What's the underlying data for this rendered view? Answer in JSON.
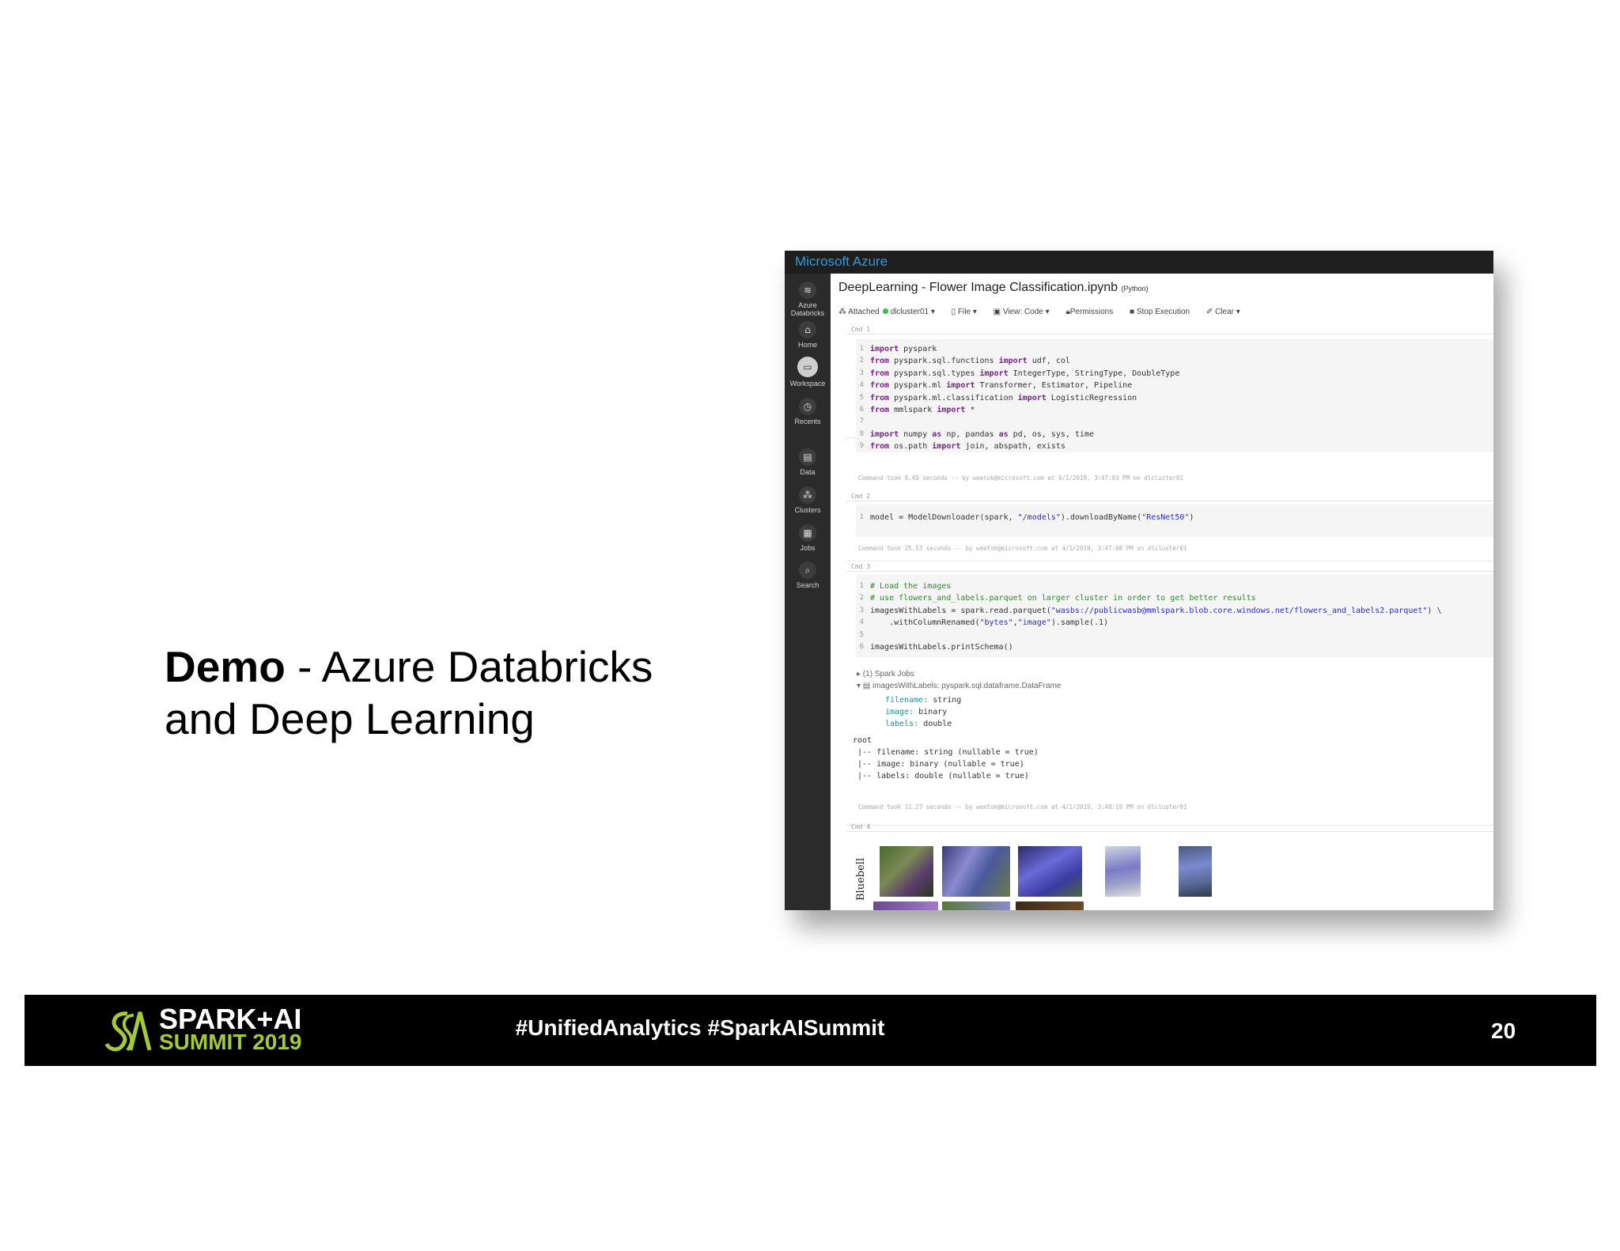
{
  "slide": {
    "title_bold": "Demo",
    "title_rest_line1": " - Azure Databricks",
    "title_line2": "and Deep Learning"
  },
  "app": {
    "brand": "Microsoft Azure",
    "notebook_title": "DeepLearning - Flower Image Classification.ipynb",
    "language": "(Python)"
  },
  "sidebar": {
    "items": [
      {
        "label": "Azure Databricks",
        "icon": "layers-icon"
      },
      {
        "label": "Home",
        "icon": "home-icon"
      },
      {
        "label": "Workspace",
        "icon": "folder-icon"
      },
      {
        "label": "Recents",
        "icon": "clock-icon"
      },
      {
        "label": "Data",
        "icon": "database-icon"
      },
      {
        "label": "Clusters",
        "icon": "cluster-icon"
      },
      {
        "label": "Jobs",
        "icon": "calendar-icon"
      },
      {
        "label": "Search",
        "icon": "search-icon"
      }
    ]
  },
  "toolbar": {
    "attached": "Attached",
    "cluster": "dlcluster01 ▾",
    "file": "File ▾",
    "view": "View: Code ▾",
    "permissions": "Permissions",
    "stop": "Stop Execution",
    "clear": "Clear ▾"
  },
  "cells": {
    "cmd1": {
      "label": "Cmd 1",
      "took": "Command took 0.48 seconds -- by weetok@microsoft.com at 4/1/2019, 3:47:03 PM on dlcluster01"
    },
    "cmd2": {
      "label": "Cmd 2",
      "took": "Command took 25.53 seconds -- by weetok@microsoft.com at 4/1/2019, 3:47:08 PM on dlcluster01"
    },
    "cmd3": {
      "label": "Cmd 3",
      "spark_jobs": "▸ (1) Spark Jobs",
      "df_line": "▾ ▤  imagesWithLabels:  pyspark.sql.dataframe.DataFrame",
      "took": "Command took 11.27 seconds -- by weetok@microsoft.com at 4/1/2019, 3:48:19 PM on dlcluster01"
    },
    "cmd4": {
      "label": "Cmd 4",
      "row_label": "Bluebell"
    }
  },
  "footer": {
    "logo_line1": "SPARK+AI",
    "logo_line2": "SUMMIT 2019",
    "hashtags": "#UnifiedAnalytics #SparkAISummit",
    "page_number": "20"
  }
}
